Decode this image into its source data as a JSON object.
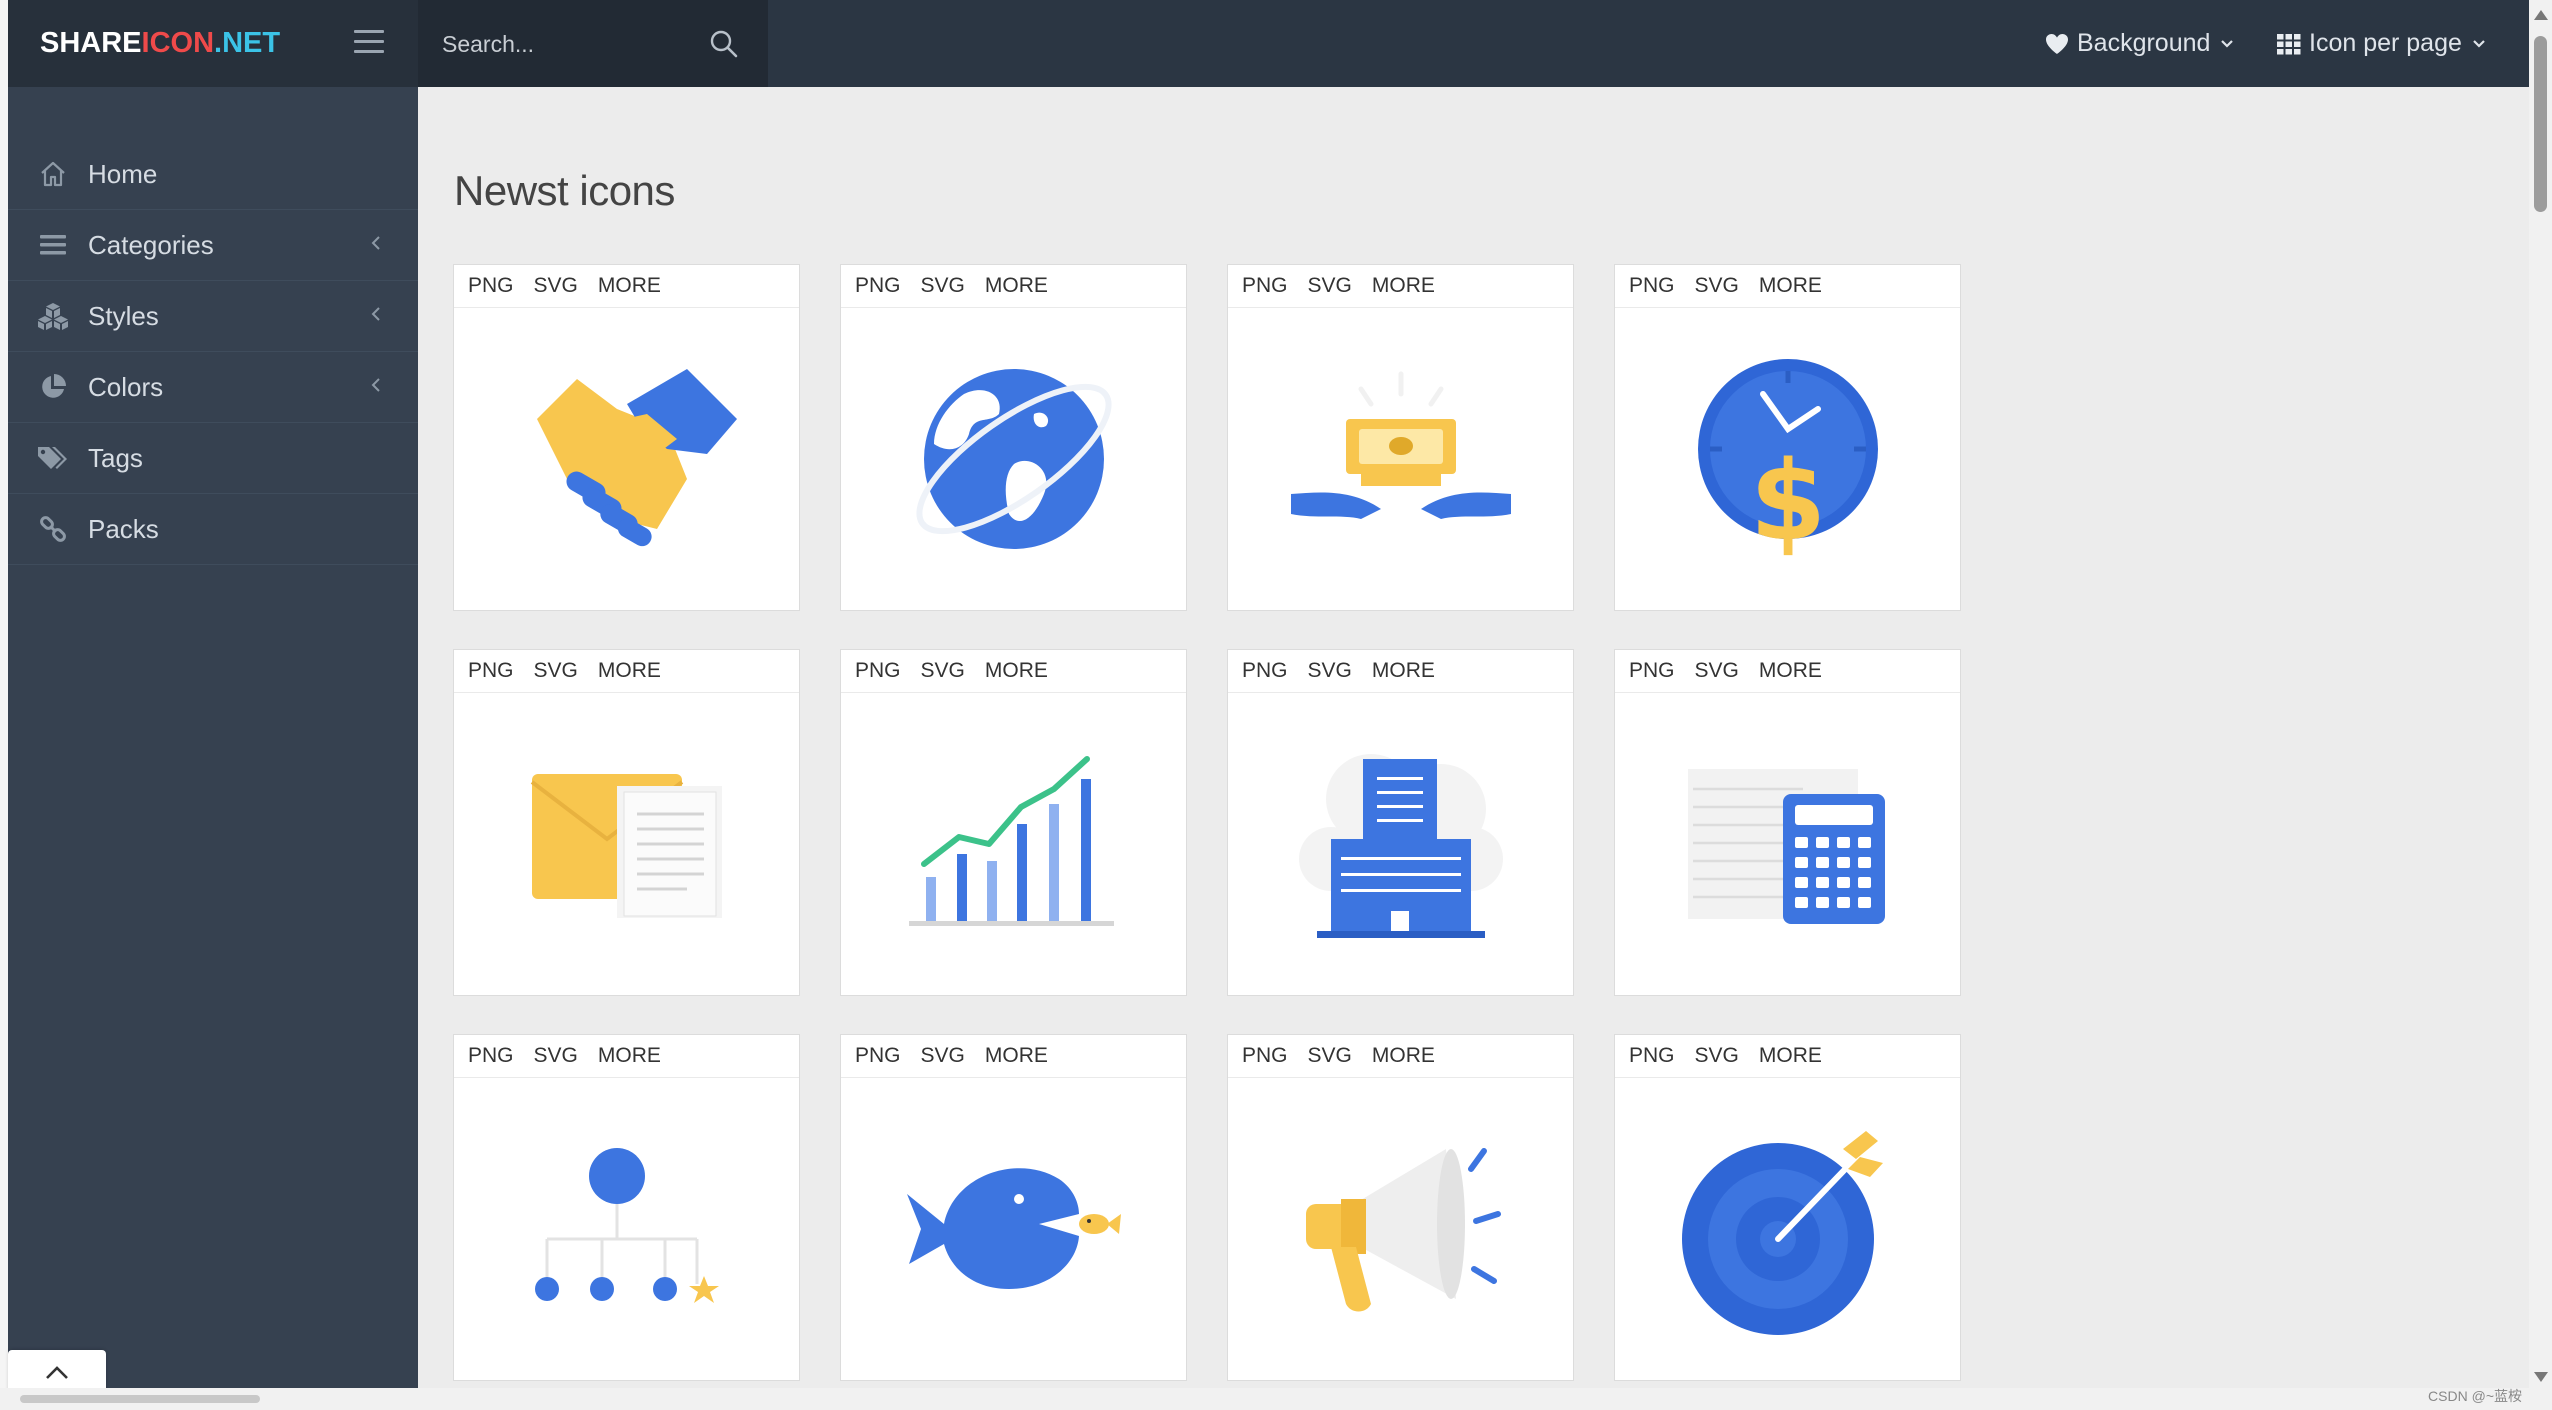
{
  "brand": {
    "logo_part1": "SHARE",
    "logo_part2": "ICON",
    "logo_part3": ".NET"
  },
  "search": {
    "placeholder": "Search..."
  },
  "nav": {
    "background_label": "Background",
    "icon_per_page_label": "Icon per page"
  },
  "sidebar": {
    "items": [
      {
        "label": "Home",
        "icon": "home-icon",
        "has_arrow": false
      },
      {
        "label": "Categories",
        "icon": "list-icon",
        "has_arrow": true
      },
      {
        "label": "Styles",
        "icon": "cubes-icon",
        "has_arrow": true
      },
      {
        "label": "Colors",
        "icon": "pie-chart-icon",
        "has_arrow": true
      },
      {
        "label": "Tags",
        "icon": "tags-icon",
        "has_arrow": false
      },
      {
        "label": "Packs",
        "icon": "link-icon",
        "has_arrow": false
      }
    ]
  },
  "main": {
    "title": "Newst icons",
    "card_actions": {
      "png": "PNG",
      "svg": "SVG",
      "more": "MORE"
    },
    "icons": [
      {
        "name": "handshake-icon"
      },
      {
        "name": "globe-icon"
      },
      {
        "name": "money-hands-icon"
      },
      {
        "name": "clock-dollar-icon"
      },
      {
        "name": "folder-document-icon"
      },
      {
        "name": "growth-chart-icon"
      },
      {
        "name": "office-building-icon"
      },
      {
        "name": "calculator-document-icon"
      },
      {
        "name": "org-hierarchy-icon"
      },
      {
        "name": "big-fish-icon"
      },
      {
        "name": "megaphone-icon"
      },
      {
        "name": "target-arrow-icon"
      }
    ]
  },
  "watermark": "CSDN @~蓝桉",
  "colors": {
    "header": "#2b3643",
    "sidebar": "#364150",
    "icon_blue": "#3d75e0",
    "icon_yellow": "#f8c64e",
    "icon_green": "#3cc28a",
    "logo_red": "#ef4a4a",
    "logo_cyan": "#3bc3e7"
  }
}
